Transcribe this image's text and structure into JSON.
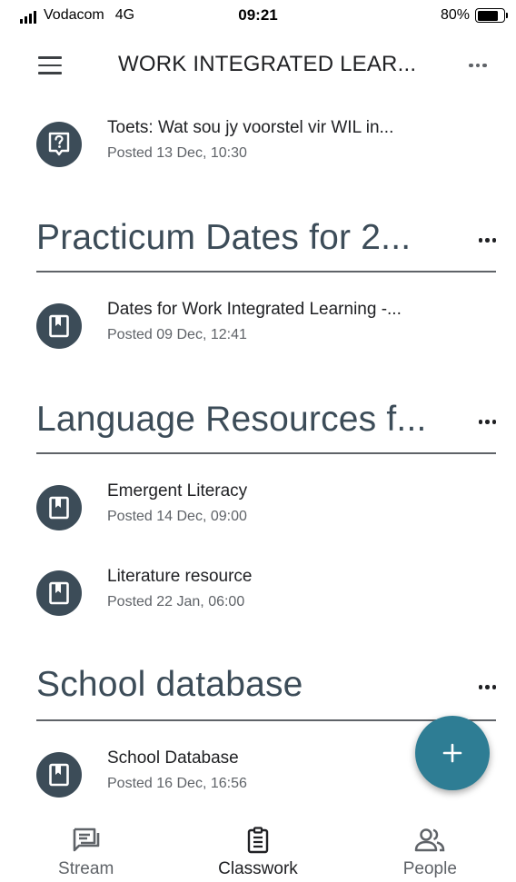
{
  "status_bar": {
    "carrier": "Vodacom",
    "network": "4G",
    "time": "09:21",
    "battery": "80%",
    "battery_level": 0.8
  },
  "app_bar": {
    "title": "WORK INTEGRATED LEAR..."
  },
  "items_top": [
    {
      "title": "Toets: Wat sou jy voorstel vir WIL in...",
      "posted": "Posted 13 Dec, 10:30",
      "icon": "quiz-icon"
    }
  ],
  "sections": [
    {
      "title": "Practicum Dates for 2...",
      "items": [
        {
          "title": "Dates for Work Integrated Learning -...",
          "posted": "Posted 09 Dec, 12:41",
          "icon": "material-icon"
        }
      ]
    },
    {
      "title": "Language Resources f...",
      "items": [
        {
          "title": "Emergent Literacy",
          "posted": "Posted 14 Dec, 09:00",
          "icon": "material-icon"
        },
        {
          "title": "Literature resource",
          "posted": "Posted 22 Jan, 06:00",
          "icon": "material-icon"
        }
      ]
    },
    {
      "title": "School database",
      "items": [
        {
          "title": "School Database",
          "posted": "Posted 16 Dec, 16:56",
          "icon": "material-icon"
        }
      ]
    }
  ],
  "bottom_nav": [
    {
      "label": "Stream",
      "icon": "stream-icon",
      "active": false
    },
    {
      "label": "Classwork",
      "icon": "classwork-icon",
      "active": true
    },
    {
      "label": "People",
      "icon": "people-icon",
      "active": false
    }
  ],
  "colors": {
    "icon_circle": "#3c4c58",
    "fab": "#2e7d94",
    "section_title": "#3c4c58"
  }
}
